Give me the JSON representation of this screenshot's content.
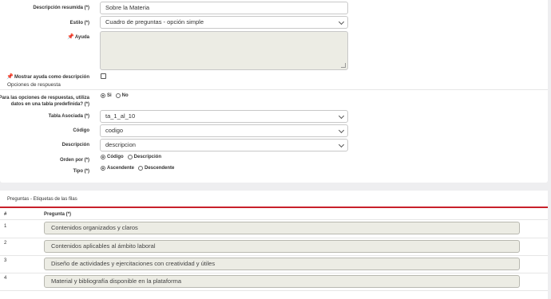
{
  "form": {
    "descripcion_resumida": {
      "label": "Descripción resumida (*)",
      "value": "Sobre la Materia"
    },
    "estilo": {
      "label": "Estilo (*)",
      "value": "Cuadro de preguntas - opción simple"
    },
    "ayuda": {
      "label": "Ayuda",
      "value": ""
    },
    "mostrar_ayuda": {
      "label": "Mostrar ayuda como descripción",
      "checked": false
    },
    "opciones_respuesta_title": "Opciones de respuesta",
    "usa_tabla": {
      "label": "¿Para las opciones de respuestas, utiliza datos en una tabla predefinida? (*)",
      "options": [
        "Si",
        "No"
      ],
      "selected": "Si"
    },
    "tabla_asociada": {
      "label": "Tabla Asociada (*)",
      "value": "ta_1_al_10"
    },
    "codigo": {
      "label": "Código",
      "value": "codigo"
    },
    "descripcion": {
      "label": "Descripción",
      "value": "descripcion"
    },
    "orden_por": {
      "label": "Orden por (*)",
      "options": [
        "Código",
        "Descripción"
      ],
      "selected": "Código"
    },
    "tipo": {
      "label": "Tipo (*)",
      "options": [
        "Ascendente",
        "Descendente"
      ],
      "selected": "Ascendente"
    }
  },
  "preguntas": {
    "title": "Preguntas - Etiquetas de las filas",
    "col_num": "#",
    "col_pregunta": "Pregunta (*)",
    "rows": [
      {
        "num": "1",
        "text": "Contenidos organizados y claros"
      },
      {
        "num": "2",
        "text": "Contenidos  aplicables al ámbito laboral"
      },
      {
        "num": "3",
        "text": "Diseño de actividades y ejercitaciones con creatividad y útiles"
      },
      {
        "num": "4",
        "text": "Material y bibliografía disponible en la plataforma"
      }
    ]
  },
  "icons": {
    "pin": "pushpin-icon"
  },
  "colors": {
    "accent": "#c8202a"
  }
}
